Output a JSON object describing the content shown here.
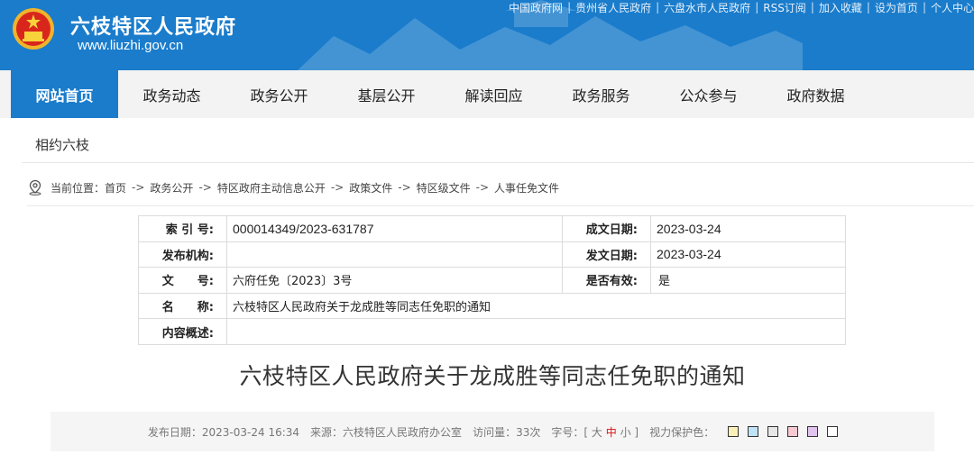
{
  "header": {
    "site_name": "六枝特区人民政府",
    "site_url": "www.liuzhi.gov.cn",
    "top_links": [
      "中国政府网",
      "贵州省人民政府",
      "六盘水市人民政府",
      "RSS订阅",
      "加入收藏",
      "设为首页",
      "个人中心"
    ],
    "separator": "|",
    "brand_color": "#1a7ccb"
  },
  "nav": {
    "items": [
      "网站首页",
      "政务动态",
      "政务公开",
      "基层公开",
      "解读回应",
      "政务服务",
      "公众参与",
      "政府数据"
    ],
    "active_index": 0
  },
  "section": {
    "title": "相约六枝"
  },
  "breadcrumb": {
    "prefix": "当前位置：",
    "items": [
      "首页",
      "政务公开",
      "特区政府主动信息公开",
      "政策文件",
      "特区级文件",
      "人事任免文件"
    ],
    "arrow": "->"
  },
  "info": {
    "index_label": "索 引 号:",
    "index_value": "000014349/2023-631787",
    "created_label": "成文日期:",
    "created_value": "2023-03-24",
    "publisher_label": "发布机构:",
    "publisher_value": "",
    "issued_label": "发文日期:",
    "issued_value": "2023-03-24",
    "docno_label": "文　　号:",
    "docno_value": "六府任免〔2023〕3号",
    "valid_label": "是否有效:",
    "valid_value": "是",
    "name_label": "名　　称:",
    "name_value": "六枝特区人民政府关于龙成胜等同志任免职的通知",
    "summary_label": "内容概述:",
    "summary_value": ""
  },
  "article": {
    "title": "六枝特区人民政府关于龙成胜等同志任免职的通知"
  },
  "meta": {
    "publish_label": "发布日期：",
    "publish_value": "2023-03-24 16:34",
    "source_label": "来源：",
    "source_value": "六枝特区人民政府办公室",
    "views_label": "访问量：",
    "views_value": "33次",
    "fontsize_label": "字号：",
    "fontsize_open": "[",
    "fontsize_large": "大",
    "fontsize_mid": "中",
    "fontsize_small": "小",
    "fontsize_close": "]",
    "eyecare_label": "视力保护色：",
    "eyecare_colors": [
      "#f9f1b8",
      "#bfe3f7",
      "#e6e6e6",
      "#f7c9d3",
      "#e2c3f0",
      "#ffffff"
    ]
  }
}
